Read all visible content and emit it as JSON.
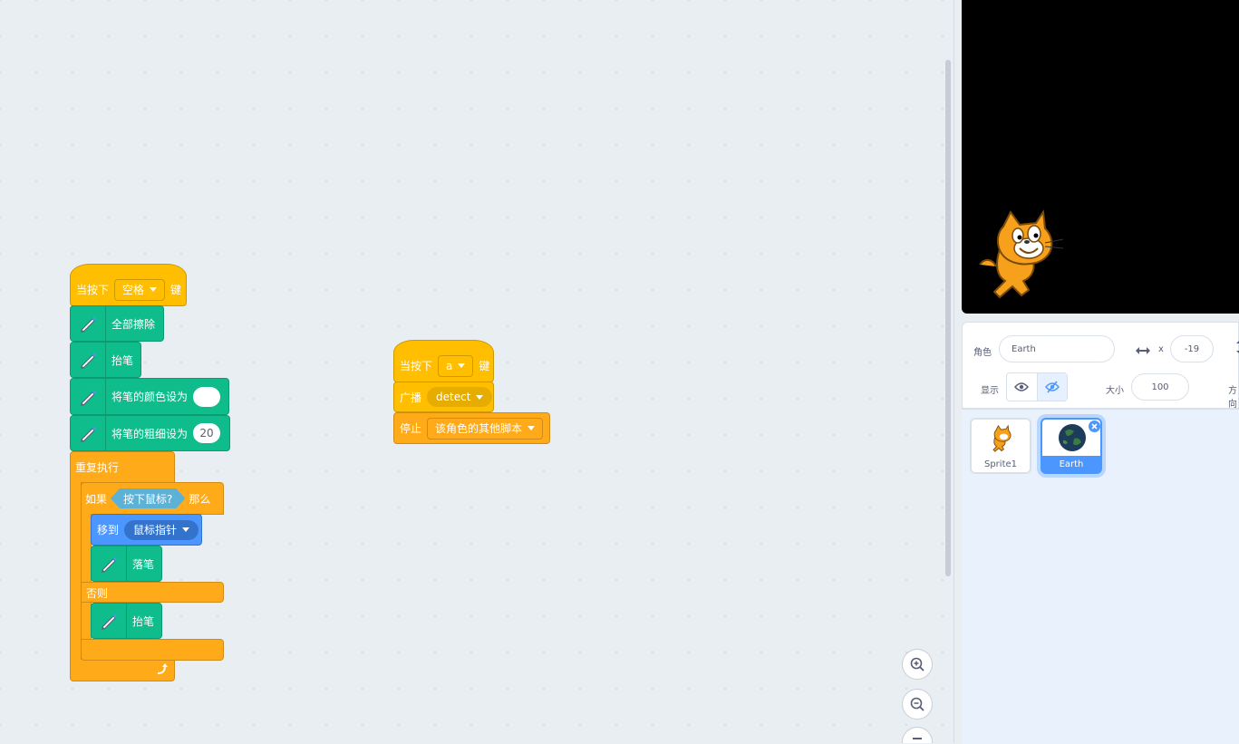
{
  "script1": {
    "hat": {
      "prefix": "当按下",
      "key": "空格",
      "suffix": "键"
    },
    "clear": "全部擦除",
    "pen_up_1": "抬笔",
    "set_color": "将笔的颜色设为",
    "set_size": "将笔的粗细设为",
    "size_value": "20",
    "forever": "重复执行",
    "if_label": "如果",
    "condition": "按下鼠标?",
    "then_label": "那么",
    "goto_label": "移到",
    "goto_target": "鼠标指针",
    "pen_down": "落笔",
    "else_label": "否则",
    "pen_up_2": "抬笔"
  },
  "script2": {
    "hat": {
      "prefix": "当按下",
      "key": "a",
      "suffix": "键"
    },
    "broadcast_label": "广播",
    "broadcast_msg": "detect",
    "stop_label": "停止",
    "stop_option": "该角色的其他脚本"
  },
  "sprite_info": {
    "sprite_label": "角色",
    "sprite_name": "Earth",
    "x_label": "x",
    "x_value": "-19",
    "show_label": "显示",
    "size_label": "大小",
    "size_value": "100",
    "direction_label": "方向"
  },
  "sprites": [
    {
      "name": "Sprite1",
      "selected": false
    },
    {
      "name": "Earth",
      "selected": true
    }
  ],
  "colors": {
    "events": "#ffbf00",
    "control": "#ffab19",
    "pen": "#0fbd8c",
    "motion": "#4c97ff",
    "sensing": "#5cb1d6",
    "selected": "#4c97ff"
  },
  "icons": [
    "pen-icon",
    "repeat-arrow-icon",
    "eye-icon",
    "eye-slash-icon",
    "arrows-horizontal-icon",
    "delete-icon",
    "zoom-in-icon",
    "zoom-out-icon",
    "zoom-reset-icon",
    "scratch-cat-icon",
    "earth-icon"
  ]
}
